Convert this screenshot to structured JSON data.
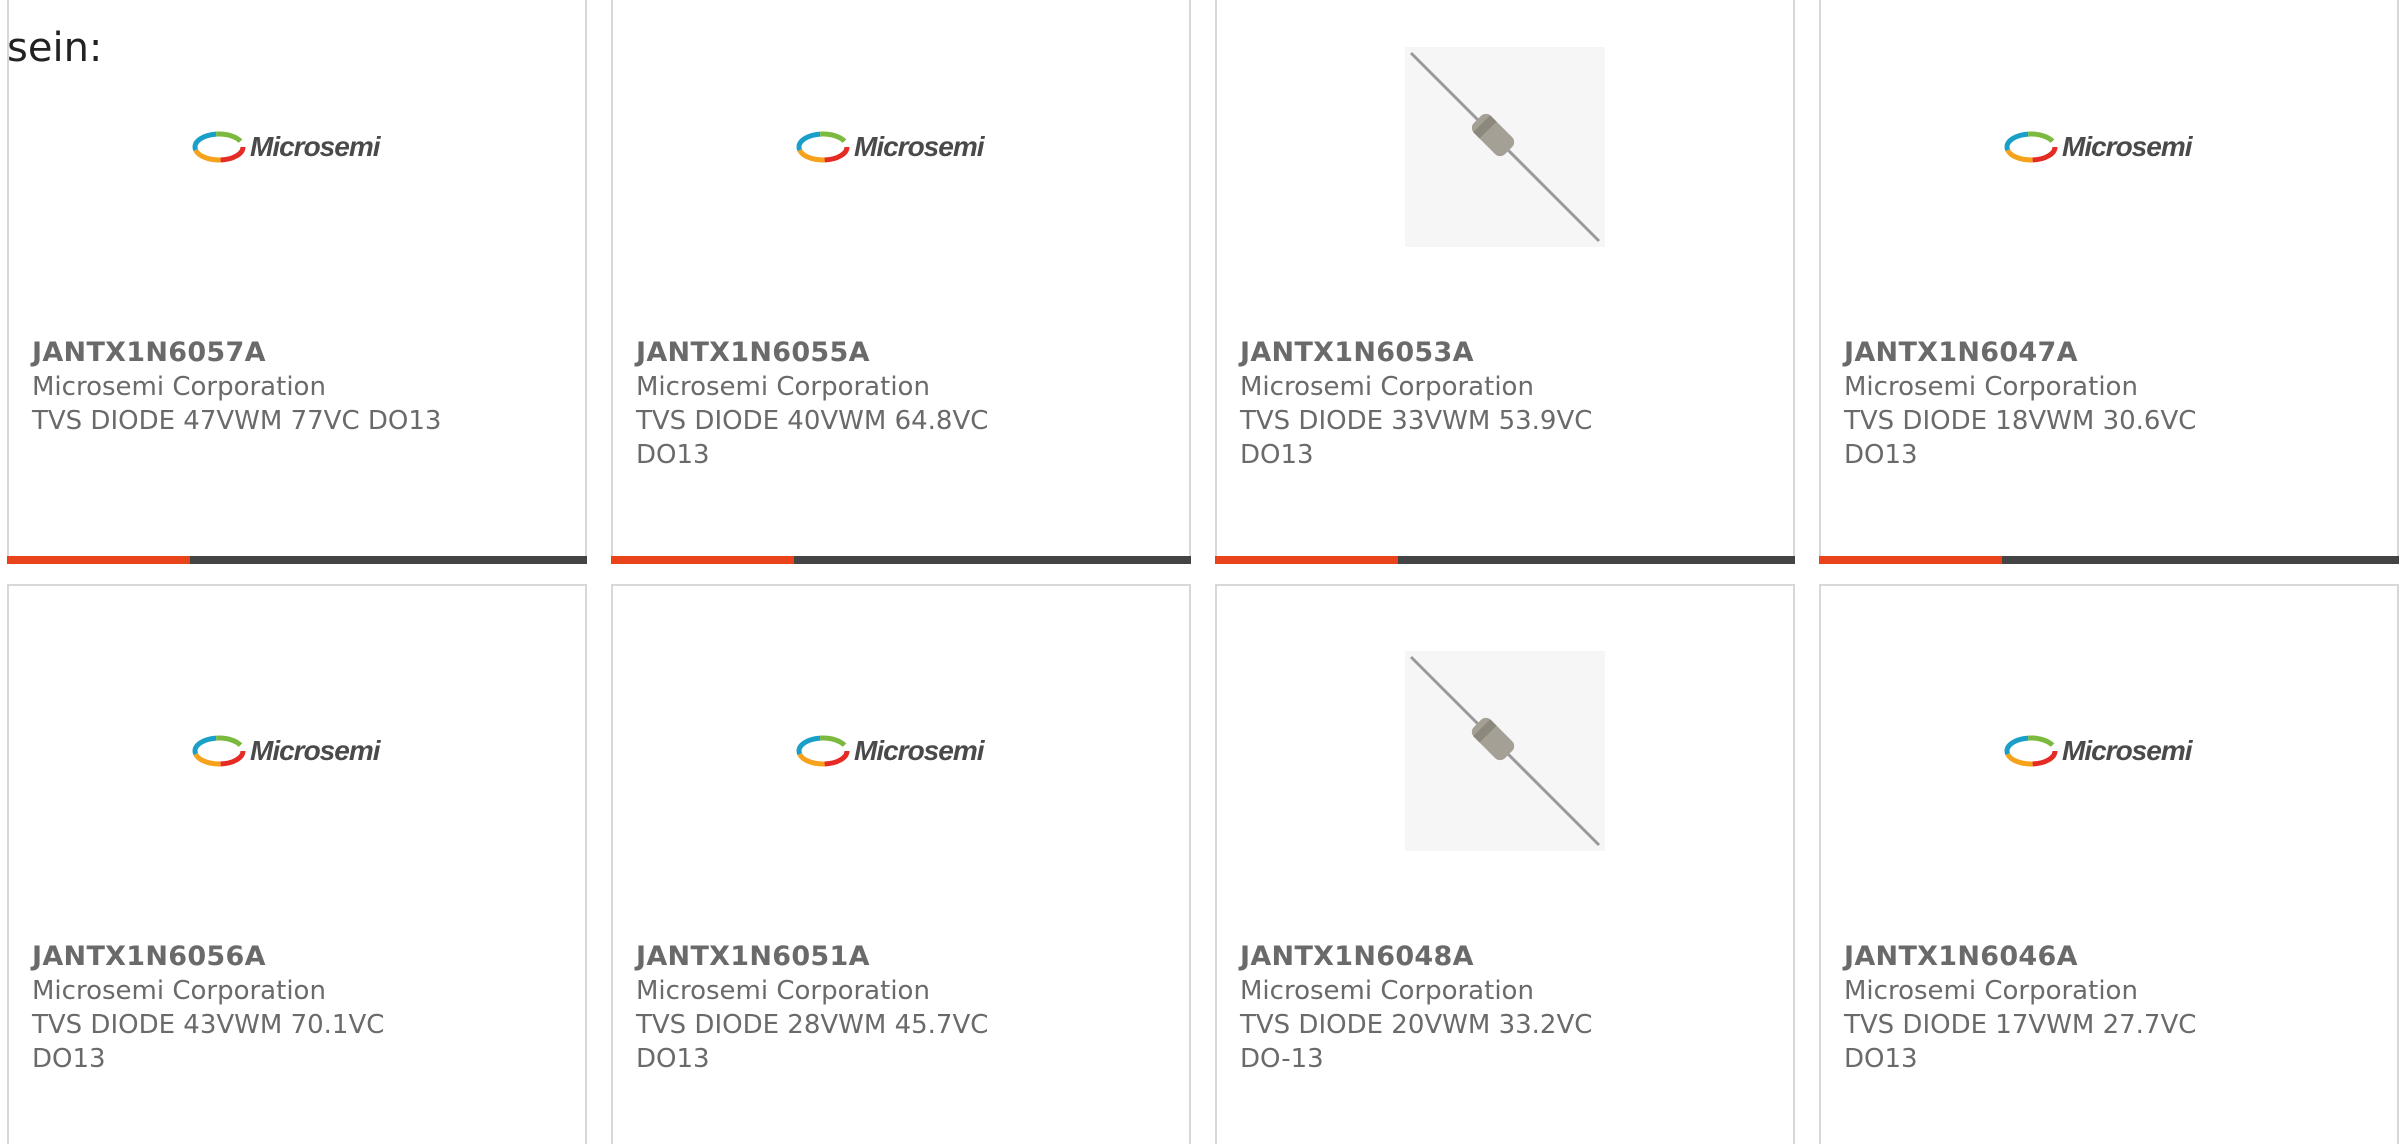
{
  "intro_text": "sein:",
  "colors": {
    "accent_orange": "#e8431a",
    "accent_dark": "#444444",
    "text_gray": "#6a6a6a",
    "card_border": "#d8d8d8"
  },
  "logo_text": "Microsemi",
  "products": [
    {
      "part": "JANTX1N6057A",
      "manufacturer": "Microsemi Corporation",
      "description": "TVS DIODE 47VWM 77VC DO13",
      "image": "microsemi-logo"
    },
    {
      "part": "JANTX1N6055A",
      "manufacturer": "Microsemi Corporation",
      "description": "TVS DIODE 40VWM 64.8VC DO13",
      "image": "microsemi-logo"
    },
    {
      "part": "JANTX1N6053A",
      "manufacturer": "Microsemi Corporation",
      "description": "TVS DIODE 33VWM 53.9VC DO13",
      "image": "diode-photo"
    },
    {
      "part": "JANTX1N6047A",
      "manufacturer": "Microsemi Corporation",
      "description": "TVS DIODE 18VWM 30.6VC DO13",
      "image": "microsemi-logo"
    },
    {
      "part": "JANTX1N6056A",
      "manufacturer": "Microsemi Corporation",
      "description": "TVS DIODE 43VWM 70.1VC DO13",
      "image": "microsemi-logo"
    },
    {
      "part": "JANTX1N6051A",
      "manufacturer": "Microsemi Corporation",
      "description": "TVS DIODE 28VWM 45.7VC DO13",
      "image": "microsemi-logo"
    },
    {
      "part": "JANTX1N6048A",
      "manufacturer": "Microsemi Corporation",
      "description": "TVS DIODE 20VWM 33.2VC DO-13",
      "image": "diode-photo"
    },
    {
      "part": "JANTX1N6046A",
      "manufacturer": "Microsemi Corporation",
      "description": "TVS DIODE 17VWM 27.7VC DO13",
      "image": "microsemi-logo"
    }
  ]
}
